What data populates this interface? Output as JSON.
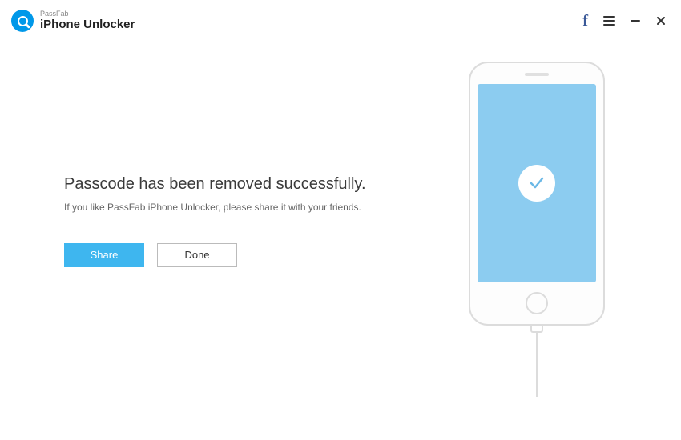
{
  "header": {
    "brand_small": "PassFab",
    "brand_title": "iPhone Unlocker"
  },
  "main": {
    "heading": "Passcode has been removed successfully.",
    "subtext": "If you like PassFab iPhone Unlocker, please share it with your friends.",
    "share_label": "Share",
    "done_label": "Done"
  },
  "colors": {
    "accent": "#3eb6ef",
    "logo": "#0098e9",
    "screen": "#8cccf0",
    "facebook": "#3b5998"
  }
}
